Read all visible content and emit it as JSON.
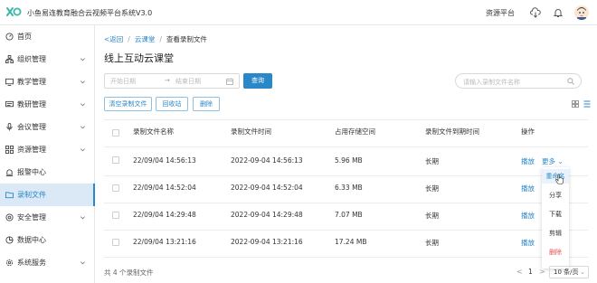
{
  "header": {
    "app_title": "小鱼易连教育融合云视频平台系统V3.0",
    "platform_link": "资源平台",
    "icons": [
      "logo-icon",
      "cloud-download-icon",
      "bell-icon",
      "avatar"
    ]
  },
  "sidebar": {
    "items": [
      {
        "label": "首页",
        "icon": "dashboard-icon",
        "expandable": false
      },
      {
        "label": "组织管理",
        "icon": "org-icon",
        "expandable": true
      },
      {
        "label": "教学管理",
        "icon": "teaching-icon",
        "expandable": true
      },
      {
        "label": "教研管理",
        "icon": "research-icon",
        "expandable": true
      },
      {
        "label": "会议管理",
        "icon": "mic-icon",
        "expandable": true
      },
      {
        "label": "资源管理",
        "icon": "grid-icon",
        "expandable": true
      },
      {
        "label": "报警中心",
        "icon": "alarm-icon",
        "expandable": false
      },
      {
        "label": "录制文件",
        "icon": "folder-icon",
        "expandable": false,
        "active": true
      },
      {
        "label": "安全管理",
        "icon": "shield-icon",
        "expandable": true
      },
      {
        "label": "数据中心",
        "icon": "data-icon",
        "expandable": false
      },
      {
        "label": "系统服务",
        "icon": "gear-icon",
        "expandable": true
      }
    ]
  },
  "breadcrumb": {
    "back": "返回",
    "parent": "云课堂",
    "separator": "/",
    "current": "查看录制文件"
  },
  "page_title": "线上互动云课堂",
  "filters": {
    "start_placeholder": "开始日期",
    "range_arrow": "→",
    "end_placeholder": "结束日期",
    "query_button": "查询",
    "search_placeholder": "请输入录制文件名称"
  },
  "toolbar": {
    "clear_button": "清空录制文件",
    "recycle_button": "回收站",
    "delete_button": "删除"
  },
  "table": {
    "columns": [
      "录制文件名称",
      "录制文件时间",
      "占用存储空间",
      "录制文件到期时间",
      "操作"
    ],
    "rows": [
      {
        "name": "22/09/04 14:56:13",
        "time": "2022-09-04 14:56:13",
        "size": "5.96 MB",
        "expiry": "长期",
        "play": "播放",
        "more": "更多"
      },
      {
        "name": "22/09/04 14:52:04",
        "time": "2022-09-04 14:52:04",
        "size": "6.33 MB",
        "expiry": "长期",
        "play": "播放"
      },
      {
        "name": "22/09/04 14:29:48",
        "time": "2022-09-04 14:29:48",
        "size": "7.07 MB",
        "expiry": "长期",
        "play": "播放"
      },
      {
        "name": "22/09/04 13:21:16",
        "time": "2022-09-04 13:21:16",
        "size": "17.24 MB",
        "expiry": "长期",
        "play": "播放"
      }
    ]
  },
  "more_menu": {
    "items": [
      "重命名",
      "分享",
      "下载",
      "剪辑",
      "删除"
    ],
    "hovered": "重命名"
  },
  "footer": {
    "total": "共 4 个录制文件",
    "prev": "<",
    "page": "1",
    "next": ">",
    "page_size": "10 条/页"
  },
  "colors": {
    "accent": "#2a87c8",
    "active_bg": "#dbe9f6",
    "danger": "#e0524f",
    "logo": "#3bb8a8"
  }
}
